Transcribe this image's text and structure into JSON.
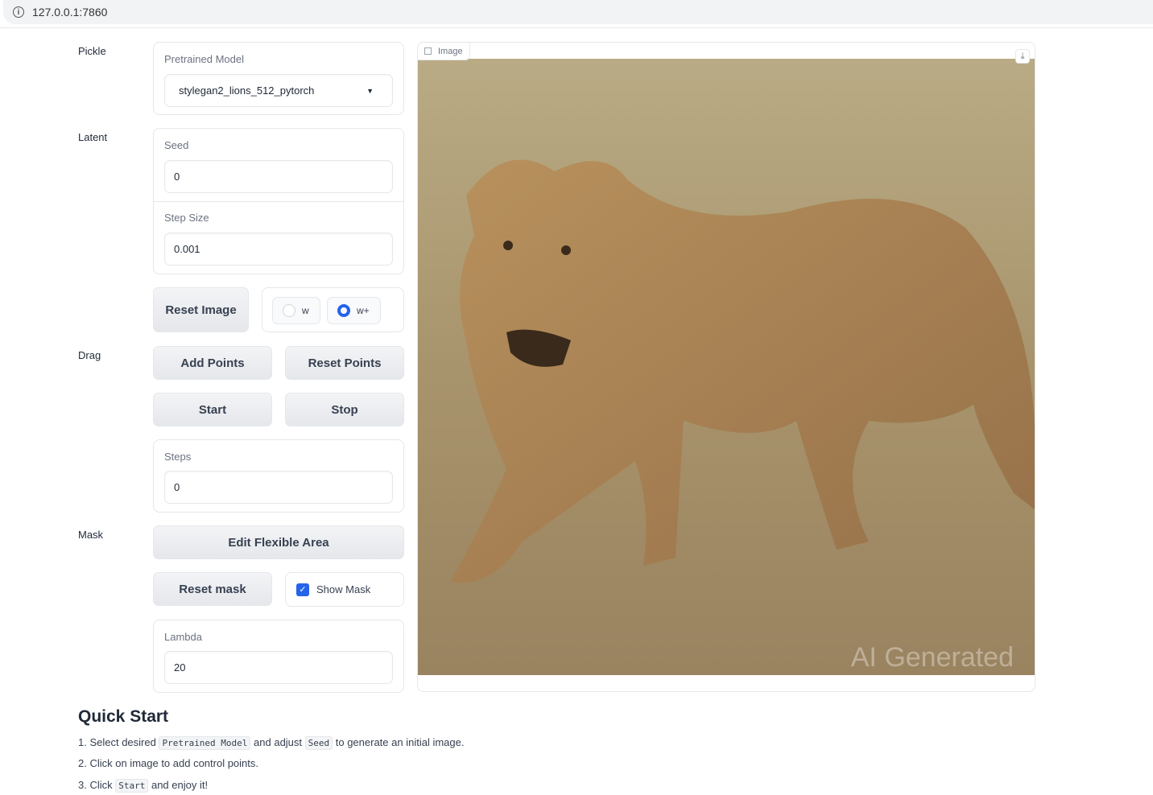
{
  "browser": {
    "url": "127.0.0.1:7860"
  },
  "sections": {
    "pickle": "Pickle",
    "latent": "Latent",
    "drag": "Drag",
    "mask": "Mask"
  },
  "pretrained_model": {
    "label": "Pretrained Model",
    "value": "stylegan2_lions_512_pytorch"
  },
  "seed": {
    "label": "Seed",
    "value": "0"
  },
  "step_size": {
    "label": "Step Size",
    "value": "0.001"
  },
  "buttons": {
    "reset_image": "Reset Image",
    "add_points": "Add Points",
    "reset_points": "Reset Points",
    "start": "Start",
    "stop": "Stop",
    "edit_flexible_area": "Edit Flexible Area",
    "reset_mask": "Reset mask"
  },
  "latent_space": {
    "options": [
      "w",
      "w+"
    ],
    "selected": "w+"
  },
  "steps": {
    "label": "Steps",
    "value": "0"
  },
  "show_mask": {
    "label": "Show Mask",
    "checked": true
  },
  "lambda": {
    "label": "Lambda",
    "value": "20"
  },
  "image": {
    "label": "Image",
    "watermark": "AI Generated"
  },
  "quick_start": {
    "title": "Quick Start",
    "step1": {
      "a": "1. Select desired ",
      "code1": "Pretrained Model",
      "b": " and adjust ",
      "code2": "Seed",
      "c": " to generate an initial image."
    },
    "step2": "2. Click on image to add control points.",
    "step3": {
      "a": "3. Click ",
      "code": "Start",
      "b": " and enjoy it!"
    }
  },
  "colors": {
    "accent": "#2563eb"
  }
}
